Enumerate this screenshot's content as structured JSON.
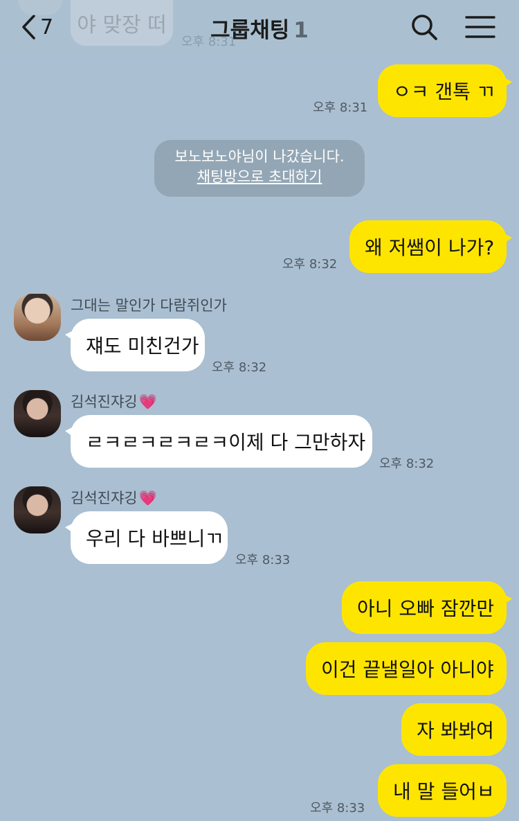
{
  "header": {
    "back_count": "7",
    "title": "그룹채팅",
    "member_count": "1"
  },
  "ghost": {
    "text": "야 맞장 떠",
    "time": "오후 8:31"
  },
  "messages": [
    {
      "from": "me",
      "text": "ㅇㅋ 갠톡 ㄲ",
      "time": "오후 8:31"
    },
    {
      "from": "me",
      "text": "왜 저쌤이 나가?",
      "time": "오후 8:32"
    },
    {
      "from": "other",
      "sender": "그대는 말인가 다람쥐인가",
      "text": "쟤도 미친건가",
      "time": "오후 8:32"
    },
    {
      "from": "other",
      "sender": "김석진쟈깅",
      "text": "ㄹㅋㄹㅋㄹㅋㄹㅋ이제 다 그만하자",
      "time": "오후 8:32"
    },
    {
      "from": "other",
      "sender": "김석진쟈깅",
      "text": "우리 다 바쁘니ㄲ",
      "time": "오후 8:33"
    },
    {
      "from": "me",
      "text": "아니 오빠 잠깐만"
    },
    {
      "from": "me",
      "text": "이건 끝낼일아 아니야"
    },
    {
      "from": "me",
      "text": "자 봐봐여"
    },
    {
      "from": "me",
      "text": "내 말 들어ㅂ",
      "time": "오후 8:33"
    }
  ],
  "system": {
    "text": "보노보노야님이 나갔습니다.",
    "link": "채팅방으로 초대하기"
  },
  "colors": {
    "background": "#aabfd1",
    "my_bubble": "#fee500",
    "other_bubble": "#ffffff",
    "system_bubble": "#93a6b5"
  },
  "icons": [
    "back-chevron-icon",
    "search-icon",
    "menu-icon",
    "heart-icon"
  ]
}
